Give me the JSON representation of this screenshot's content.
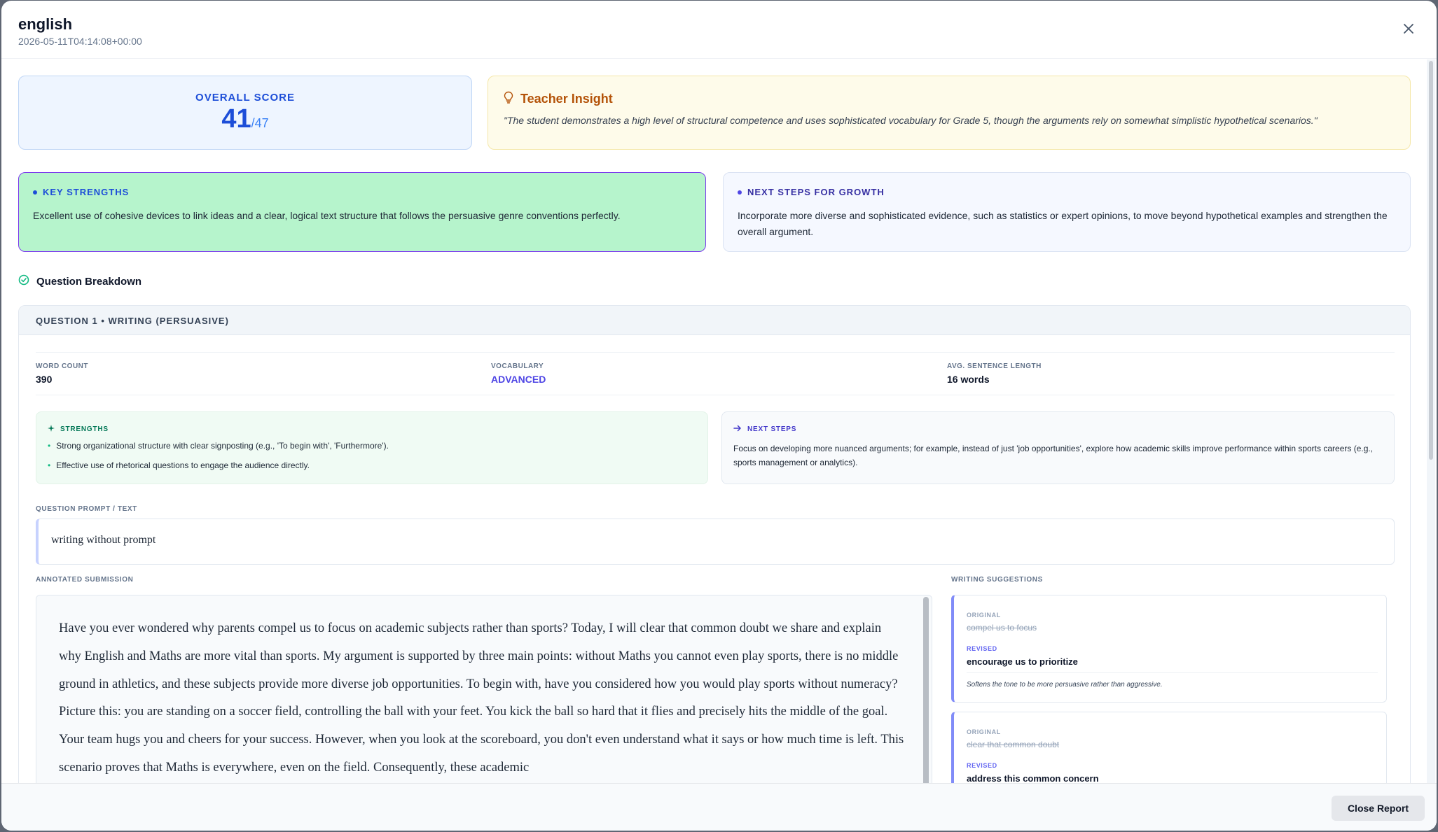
{
  "modal": {
    "title": "english",
    "timestamp": "2026-05-11T04:14:08+00:00"
  },
  "score": {
    "label": "OVERALL SCORE",
    "value": "41",
    "total": "/47"
  },
  "insight": {
    "title": "Teacher Insight",
    "quote": "\"The student demonstrates a high level of structural competence and uses sophisticated vocabulary for Grade 5, though the arguments rely on somewhat simplistic hypothetical scenarios.\""
  },
  "key_strengths": {
    "label": "KEY STRENGTHS",
    "text": "Excellent use of cohesive devices to link ideas and a clear, logical text structure that follows the persuasive genre conventions perfectly."
  },
  "growth": {
    "label": "NEXT STEPS FOR GROWTH",
    "text": "Incorporate more diverse and sophisticated evidence, such as statistics or expert opinions, to move beyond hypothetical examples and strengthen the overall argument."
  },
  "breakdown": {
    "title": "Question Breakdown"
  },
  "question": {
    "header": "QUESTION 1 • WRITING (PERSUASIVE)",
    "stats": [
      {
        "label": "WORD COUNT",
        "value": "390"
      },
      {
        "label": "VOCABULARY",
        "value": "ADVANCED"
      },
      {
        "label": "AVG. SENTENCE LENGTH",
        "value": "16 words"
      }
    ],
    "strengths_label": "STRENGTHS",
    "strengths": [
      "Strong organizational structure with clear signposting (e.g., 'To begin with', 'Furthermore').",
      "Effective use of rhetorical questions to engage the audience directly."
    ],
    "next_steps_label": "NEXT STEPS",
    "next_steps": "Focus on developing more nuanced arguments; for example, instead of just 'job opportunities', explore how academic skills improve performance within sports careers (e.g., sports management or analytics).",
    "prompt_label": "QUESTION PROMPT / TEXT",
    "prompt": "writing without prompt",
    "submission_label": "ANNOTATED SUBMISSION",
    "submission": "Have you ever wondered why parents compel us to focus on academic subjects rather than sports? Today, I will clear that common doubt we share and explain why English and Maths are more vital than sports. My argument is supported by three main points: without Maths you cannot even play sports, there is no middle ground in athletics, and these subjects provide more diverse job opportunities. To begin with, have you considered how you would play sports without numeracy? Picture this: you are standing on a soccer field, controlling the ball with your feet. You kick the ball so hard that it flies and precisely hits the middle of the goal. Your team hugs you and cheers for your success. However, when you look at the scoreboard, you don't even understand what it says or how much time is left. This scenario proves that Maths is everywhere, even on the field. Consequently, these academic",
    "suggestions_label": "WRITING SUGGESTIONS",
    "original_label": "ORIGINAL",
    "revised_label": "REVISED",
    "suggestions": [
      {
        "original": "compel us to focus",
        "revised": "encourage us to prioritize",
        "note": "Softens the tone to be more persuasive rather than aggressive."
      },
      {
        "original": "clear that common doubt",
        "revised": "address this common concern",
        "note": ""
      }
    ]
  },
  "footer": {
    "close_label": "Close Report"
  },
  "colors": {
    "accent": "#1d4ed8",
    "strength_green": "#10b981",
    "insight_orange": "#b45309",
    "indigo": "#4f46e5"
  }
}
